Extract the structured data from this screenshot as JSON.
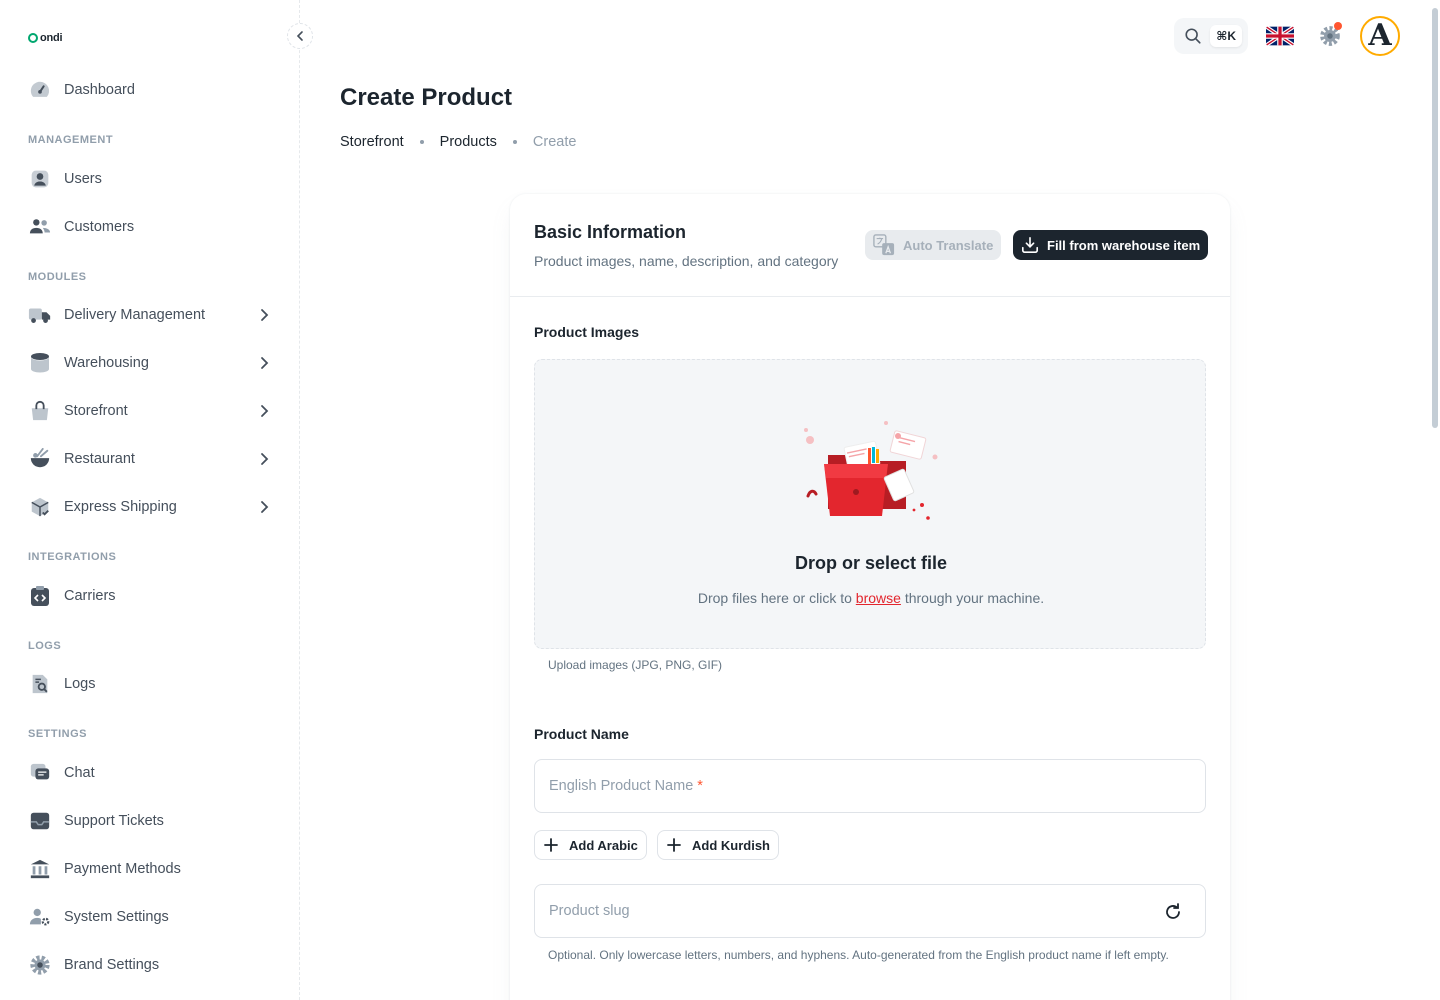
{
  "app": {
    "logo_text": "ondi"
  },
  "sidebar": {
    "dashboard": "Dashboard",
    "sections": {
      "management": "MANAGEMENT",
      "modules": "MODULES",
      "integrations": "INTEGRATIONS",
      "logs": "LOGS",
      "settings": "SETTINGS"
    },
    "items": {
      "users": "Users",
      "customers": "Customers",
      "delivery": "Delivery Management",
      "warehousing": "Warehousing",
      "storefront": "Storefront",
      "restaurant": "Restaurant",
      "express": "Express Shipping",
      "carriers": "Carriers",
      "logs": "Logs",
      "chat": "Chat",
      "support": "Support Tickets",
      "payment": "Payment Methods",
      "system": "System Settings",
      "brand": "Brand Settings"
    }
  },
  "header": {
    "shortcut": "⌘K",
    "avatar_letter": "A",
    "notification_color": "#ff5630"
  },
  "page": {
    "title": "Create Product",
    "breadcrumb": [
      "Storefront",
      "Products",
      "Create"
    ]
  },
  "card": {
    "title": "Basic Information",
    "subtitle": "Product images, name, description, and category",
    "auto_translate": "Auto Translate",
    "fill_warehouse": "Fill from warehouse item"
  },
  "images": {
    "label": "Product Images",
    "drop_title": "Drop or select file",
    "drop_prefix": "Drop files here or click to",
    "drop_link": "browse",
    "drop_suffix": "through your machine.",
    "helper": "Upload images (JPG, PNG, GIF)"
  },
  "name": {
    "label": "Product Name",
    "placeholder": "English Product Name",
    "required_mark": "*",
    "add_arabic": "Add Arabic",
    "add_kurdish": "Add Kurdish"
  },
  "slug": {
    "placeholder": "Product slug",
    "helper": "Optional. Only lowercase letters, numbers, and hyphens. Auto-generated from the English product name if left empty."
  },
  "colors": {
    "primary_dark": "#1c252e",
    "accent_red": "#e3262e",
    "brand_green": "#00a76f"
  }
}
